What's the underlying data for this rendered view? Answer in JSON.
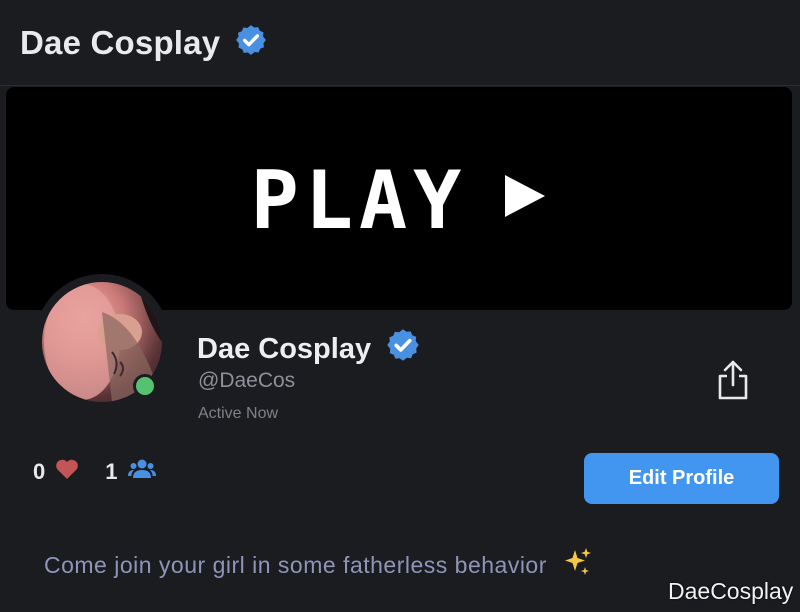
{
  "header": {
    "title": "Dae Cosplay",
    "verified_icon": "verified-badge-icon",
    "verified_color": "#4a90e2"
  },
  "banner": {
    "text": "PLAY",
    "icon": "play-triangle-icon"
  },
  "profile": {
    "avatar": "profile-avatar",
    "online_status_color": "#56c271",
    "name": "Dae Cosplay",
    "handle": "@DaeCos",
    "status": "Active Now",
    "share_icon": "share-icon"
  },
  "stats": {
    "likes": "0",
    "likes_icon": "heart-icon",
    "likes_color": "#c25555",
    "followers": "1",
    "followers_icon": "users-icon",
    "followers_color": "#4a90e2"
  },
  "actions": {
    "edit_profile_label": "Edit Profile",
    "accent": "#4296f0"
  },
  "bio": {
    "text": "Come join your girl in some fatherless behavior",
    "emoji_icon": "sparkles-icon"
  },
  "watermark": "DaeCosplay"
}
